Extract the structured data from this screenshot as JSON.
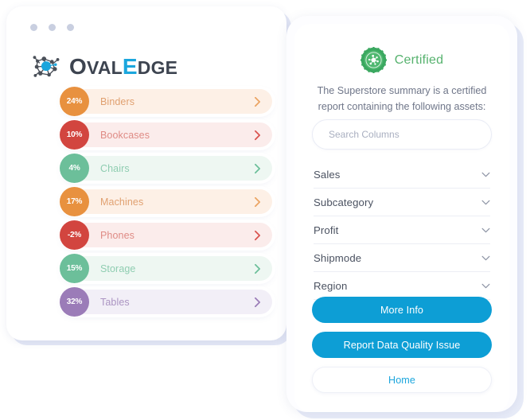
{
  "window": {
    "dots": [
      "dot-1",
      "dot-2",
      "dot-3"
    ],
    "dot_color": "#c9cfe0"
  },
  "brand": {
    "name": "OvalEdge",
    "part_o": "O",
    "part_val": "VAL",
    "part_e": "E",
    "part_dge": "DGE",
    "accent_color": "#1ba6dd",
    "text_color": "#3d4450",
    "icon": "network-nodes-icon"
  },
  "metrics": [
    {
      "percent": "24%",
      "label": "Binders",
      "badge_color": "#e8913f",
      "row_color": "#fdf0e6",
      "text_color": "#e0a070",
      "chevron_color": "#eba463"
    },
    {
      "percent": "10%",
      "label": "Bookcases",
      "badge_color": "#d2453f",
      "row_color": "#fbeceb",
      "text_color": "#df8b85",
      "chevron_color": "#d9534f"
    },
    {
      "percent": "4%",
      "label": "Chairs",
      "badge_color": "#6cbf9a",
      "row_color": "#eef7f2",
      "text_color": "#8fcdb1",
      "chevron_color": "#6cbf9a"
    },
    {
      "percent": "17%",
      "label": "Machines",
      "badge_color": "#e8913f",
      "row_color": "#fdf0e6",
      "text_color": "#e0a070",
      "chevron_color": "#eba463"
    },
    {
      "percent": "-2%",
      "label": "Phones",
      "badge_color": "#d2453f",
      "row_color": "#fbeceb",
      "text_color": "#df8b85",
      "chevron_color": "#d9534f"
    },
    {
      "percent": "15%",
      "label": "Storage",
      "badge_color": "#6cbf9a",
      "row_color": "#eef7f2",
      "text_color": "#8fcdb1",
      "chevron_color": "#6cbf9a"
    },
    {
      "percent": "32%",
      "label": "Tables",
      "badge_color": "#9b7cb8",
      "row_color": "#f2eff7",
      "text_color": "#ab94c2",
      "chevron_color": "#9b7cb8"
    }
  ],
  "panel": {
    "certified": {
      "label": "Certified",
      "icon": "certified-seal-icon",
      "color": "#56b26e"
    },
    "summary": "The Superstore summary is a certified report containing the following assets:",
    "search": {
      "placeholder": "Search Columns",
      "value": ""
    },
    "assets": [
      {
        "label": "Sales",
        "icon": "chevron-down-icon"
      },
      {
        "label": "Subcategory",
        "icon": "chevron-down-icon"
      },
      {
        "label": "Profit",
        "icon": "chevron-down-icon"
      },
      {
        "label": "Shipmode",
        "icon": "chevron-down-icon"
      },
      {
        "label": "Region",
        "icon": "chevron-down-icon"
      }
    ],
    "buttons": [
      {
        "label": "More Info",
        "style": "primary"
      },
      {
        "label": "Report Data Quality Issue",
        "style": "primary"
      },
      {
        "label": "Home",
        "style": "outline"
      }
    ],
    "primary_color": "#0d9ed5"
  }
}
